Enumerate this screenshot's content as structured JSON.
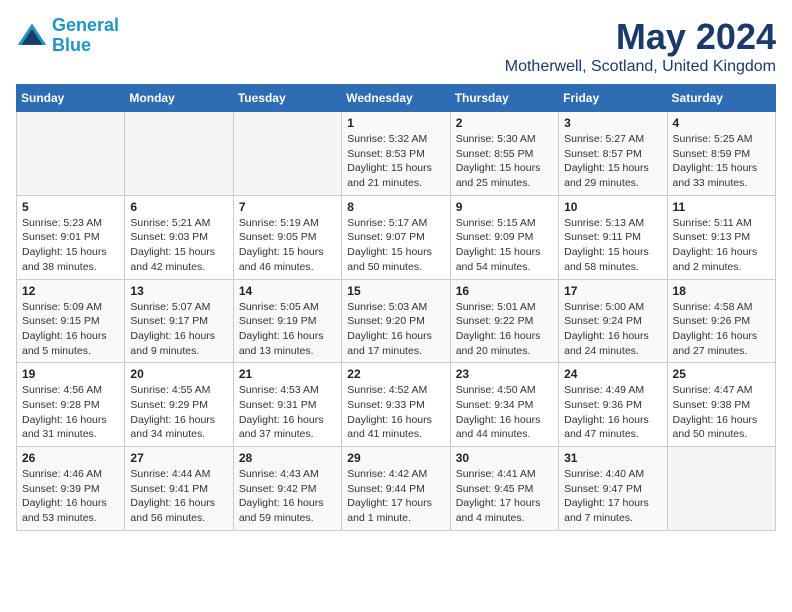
{
  "header": {
    "logo_line1": "General",
    "logo_line2": "Blue",
    "month": "May 2024",
    "location": "Motherwell, Scotland, United Kingdom"
  },
  "weekdays": [
    "Sunday",
    "Monday",
    "Tuesday",
    "Wednesday",
    "Thursday",
    "Friday",
    "Saturday"
  ],
  "weeks": [
    [
      {
        "day": "",
        "info": ""
      },
      {
        "day": "",
        "info": ""
      },
      {
        "day": "",
        "info": ""
      },
      {
        "day": "1",
        "info": "Sunrise: 5:32 AM\nSunset: 8:53 PM\nDaylight: 15 hours and 21 minutes."
      },
      {
        "day": "2",
        "info": "Sunrise: 5:30 AM\nSunset: 8:55 PM\nDaylight: 15 hours and 25 minutes."
      },
      {
        "day": "3",
        "info": "Sunrise: 5:27 AM\nSunset: 8:57 PM\nDaylight: 15 hours and 29 minutes."
      },
      {
        "day": "4",
        "info": "Sunrise: 5:25 AM\nSunset: 8:59 PM\nDaylight: 15 hours and 33 minutes."
      }
    ],
    [
      {
        "day": "5",
        "info": "Sunrise: 5:23 AM\nSunset: 9:01 PM\nDaylight: 15 hours and 38 minutes."
      },
      {
        "day": "6",
        "info": "Sunrise: 5:21 AM\nSunset: 9:03 PM\nDaylight: 15 hours and 42 minutes."
      },
      {
        "day": "7",
        "info": "Sunrise: 5:19 AM\nSunset: 9:05 PM\nDaylight: 15 hours and 46 minutes."
      },
      {
        "day": "8",
        "info": "Sunrise: 5:17 AM\nSunset: 9:07 PM\nDaylight: 15 hours and 50 minutes."
      },
      {
        "day": "9",
        "info": "Sunrise: 5:15 AM\nSunset: 9:09 PM\nDaylight: 15 hours and 54 minutes."
      },
      {
        "day": "10",
        "info": "Sunrise: 5:13 AM\nSunset: 9:11 PM\nDaylight: 15 hours and 58 minutes."
      },
      {
        "day": "11",
        "info": "Sunrise: 5:11 AM\nSunset: 9:13 PM\nDaylight: 16 hours and 2 minutes."
      }
    ],
    [
      {
        "day": "12",
        "info": "Sunrise: 5:09 AM\nSunset: 9:15 PM\nDaylight: 16 hours and 5 minutes."
      },
      {
        "day": "13",
        "info": "Sunrise: 5:07 AM\nSunset: 9:17 PM\nDaylight: 16 hours and 9 minutes."
      },
      {
        "day": "14",
        "info": "Sunrise: 5:05 AM\nSunset: 9:19 PM\nDaylight: 16 hours and 13 minutes."
      },
      {
        "day": "15",
        "info": "Sunrise: 5:03 AM\nSunset: 9:20 PM\nDaylight: 16 hours and 17 minutes."
      },
      {
        "day": "16",
        "info": "Sunrise: 5:01 AM\nSunset: 9:22 PM\nDaylight: 16 hours and 20 minutes."
      },
      {
        "day": "17",
        "info": "Sunrise: 5:00 AM\nSunset: 9:24 PM\nDaylight: 16 hours and 24 minutes."
      },
      {
        "day": "18",
        "info": "Sunrise: 4:58 AM\nSunset: 9:26 PM\nDaylight: 16 hours and 27 minutes."
      }
    ],
    [
      {
        "day": "19",
        "info": "Sunrise: 4:56 AM\nSunset: 9:28 PM\nDaylight: 16 hours and 31 minutes."
      },
      {
        "day": "20",
        "info": "Sunrise: 4:55 AM\nSunset: 9:29 PM\nDaylight: 16 hours and 34 minutes."
      },
      {
        "day": "21",
        "info": "Sunrise: 4:53 AM\nSunset: 9:31 PM\nDaylight: 16 hours and 37 minutes."
      },
      {
        "day": "22",
        "info": "Sunrise: 4:52 AM\nSunset: 9:33 PM\nDaylight: 16 hours and 41 minutes."
      },
      {
        "day": "23",
        "info": "Sunrise: 4:50 AM\nSunset: 9:34 PM\nDaylight: 16 hours and 44 minutes."
      },
      {
        "day": "24",
        "info": "Sunrise: 4:49 AM\nSunset: 9:36 PM\nDaylight: 16 hours and 47 minutes."
      },
      {
        "day": "25",
        "info": "Sunrise: 4:47 AM\nSunset: 9:38 PM\nDaylight: 16 hours and 50 minutes."
      }
    ],
    [
      {
        "day": "26",
        "info": "Sunrise: 4:46 AM\nSunset: 9:39 PM\nDaylight: 16 hours and 53 minutes."
      },
      {
        "day": "27",
        "info": "Sunrise: 4:44 AM\nSunset: 9:41 PM\nDaylight: 16 hours and 56 minutes."
      },
      {
        "day": "28",
        "info": "Sunrise: 4:43 AM\nSunset: 9:42 PM\nDaylight: 16 hours and 59 minutes."
      },
      {
        "day": "29",
        "info": "Sunrise: 4:42 AM\nSunset: 9:44 PM\nDaylight: 17 hours and 1 minute."
      },
      {
        "day": "30",
        "info": "Sunrise: 4:41 AM\nSunset: 9:45 PM\nDaylight: 17 hours and 4 minutes."
      },
      {
        "day": "31",
        "info": "Sunrise: 4:40 AM\nSunset: 9:47 PM\nDaylight: 17 hours and 7 minutes."
      },
      {
        "day": "",
        "info": ""
      }
    ]
  ]
}
